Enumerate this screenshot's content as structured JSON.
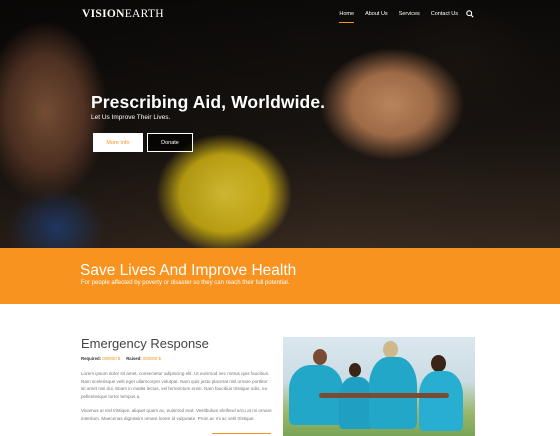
{
  "nav": {
    "logo_bold": "VISION",
    "logo_light": "EARTH",
    "links": [
      "Home",
      "About Us",
      "Services",
      "Contact Us"
    ],
    "search_icon": "search-icon"
  },
  "hero": {
    "title": "Prescribing Aid, Worldwide.",
    "subtitle": "Let Us Improve Their Lives.",
    "more_info_label": "More Info",
    "donate_label": "Donate"
  },
  "band": {
    "title": "Save Lives And Improve Health",
    "subtitle": "For people affected by poverty or disaster so they can reach their full potential."
  },
  "section": {
    "title": "Emergency Response",
    "required_label": "Required:",
    "required_value": "000000 $",
    "raised_label": "Raised:",
    "raised_value": "000000 $",
    "paragraph1": "Lorem ipsum dolor sit amet, consectetur adipiscing elit. Ut euismod nec metus quis faucibus. Nam scelerisque velit eget ullamcorper volutpat. Nam quis justo placerat nisl ornare porttitor sit amet nisi dui. Etiam in mattis lectus, vel fermentum enim. Nam faucibus tristique odio, eu pellentesque tortor tempus a.",
    "paragraph2": "Vivamus ut nisl tristique, aliquet quam ac, euismod erat. Vestibulum eleifend arcu at mi ornare interdum. Maecenas dignissim ornare lorem id vulputate. Proin ac mi ac velit tristique."
  },
  "colors": {
    "accent": "#f7931e",
    "band": "#f7931e",
    "photo_shirt": "#22a7c9"
  }
}
